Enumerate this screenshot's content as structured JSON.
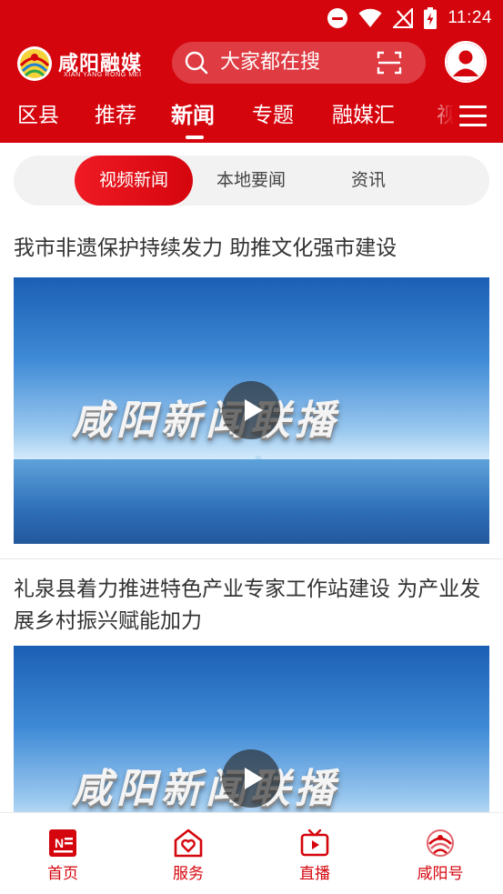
{
  "status_bar": {
    "time": "11:24",
    "icons": [
      "do-not-disturb-icon",
      "wifi-icon",
      "no-signal-icon",
      "battery-charging-icon"
    ]
  },
  "header": {
    "logo_text": "咸阳融媒",
    "logo_subtext": "XIAN YANG RONG MEI",
    "search_placeholder": "大家都在搜",
    "icons": [
      "search-icon",
      "scan-icon",
      "avatar-icon"
    ]
  },
  "channels": {
    "tabs": [
      "区县",
      "推荐",
      "新闻",
      "专题",
      "融媒汇",
      "视"
    ],
    "active_index": 2,
    "menu_icon": "hamburger-menu-icon"
  },
  "segments": {
    "items": [
      "视频新闻",
      "本地要闻",
      "资讯"
    ],
    "active_index": 0
  },
  "feed": {
    "items": [
      {
        "title": "我市非遗保护持续发力  助推文化强市建设",
        "thumbnail_text": "咸阳新闻联播",
        "type": "video"
      },
      {
        "title": "礼泉县着力推进特色产业专家工作站建设  为产业发展乡村振兴赋能加力",
        "thumbnail_text": "咸阳新闻联播",
        "type": "video"
      }
    ]
  },
  "bottom_nav": {
    "items": [
      {
        "label": "首页",
        "icon": "news-home-icon"
      },
      {
        "label": "服务",
        "icon": "heart-house-icon"
      },
      {
        "label": "直播",
        "icon": "tv-live-icon"
      },
      {
        "label": "咸阳号",
        "icon": "xianyang-logo-icon"
      }
    ]
  },
  "colors": {
    "brand_red": "#d5050d",
    "text": "#333333",
    "segment_bg": "#f2f2f2",
    "sky_blue": "#3f8ad6"
  }
}
